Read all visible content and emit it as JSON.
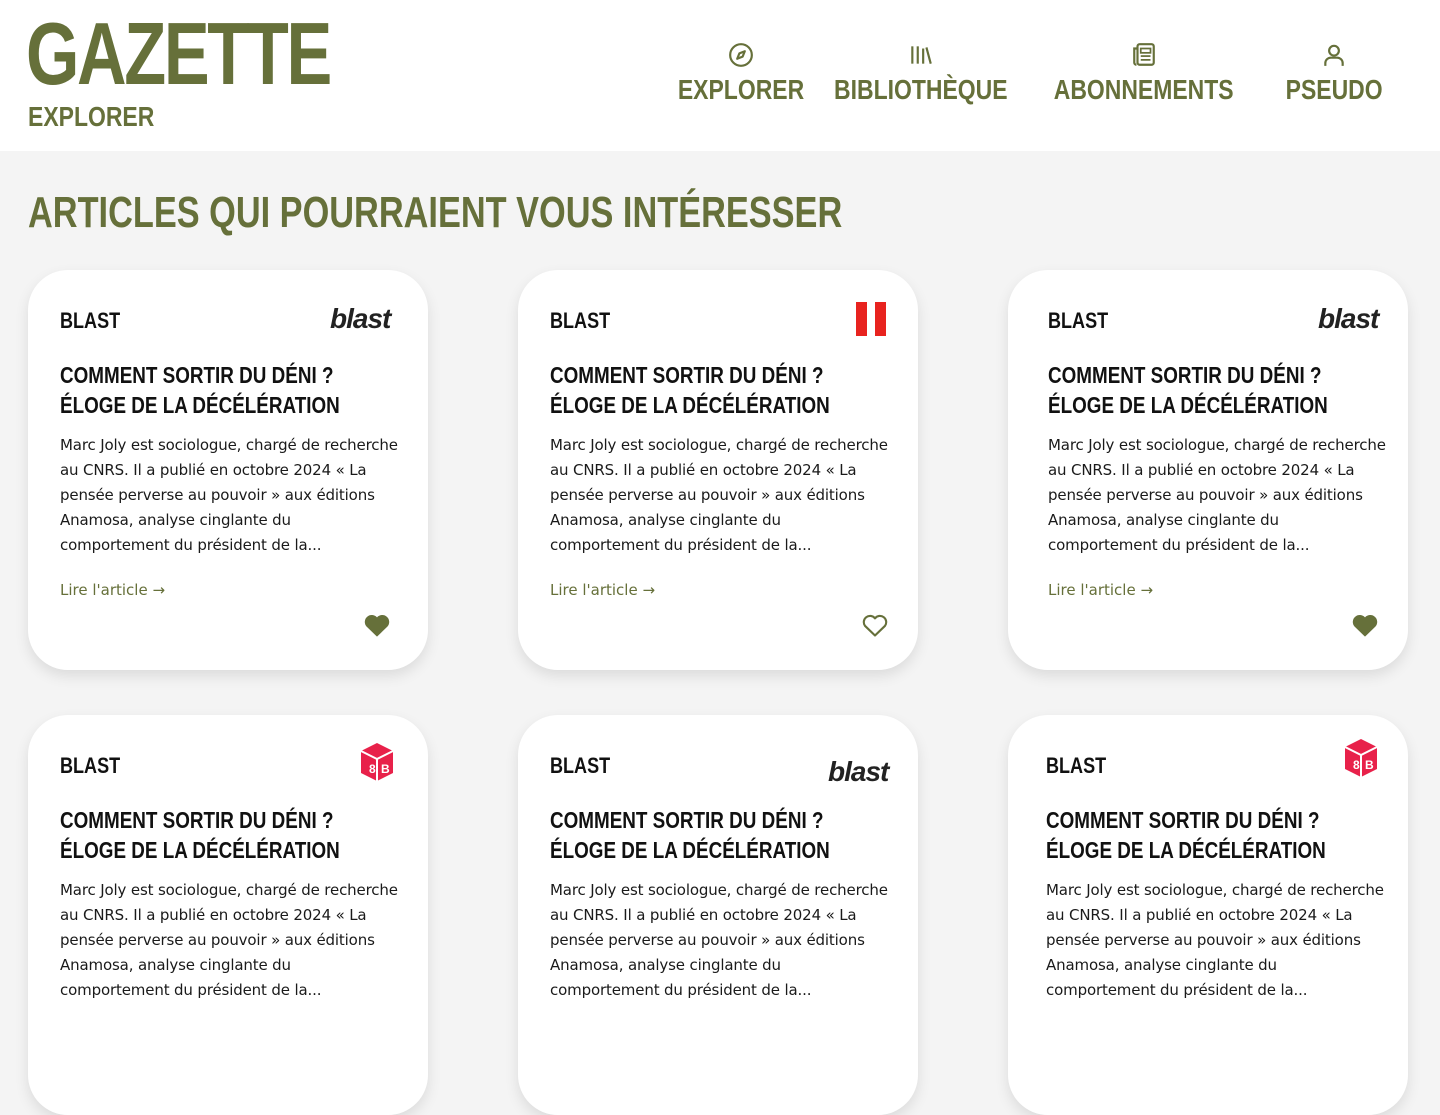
{
  "header": {
    "logo": "GAZETTE",
    "subtitle": "EXPLORER",
    "nav": [
      {
        "label": "EXPLORER",
        "icon": "compass-icon"
      },
      {
        "label": "BIBLIOTHÈQUE",
        "icon": "library-icon"
      },
      {
        "label": "ABONNEMENTS",
        "icon": "newspaper-icon"
      },
      {
        "label": "PSEUDO",
        "icon": "user-icon"
      }
    ]
  },
  "main": {
    "section_title": "ARTICLES QUI POURRAIENT VOUS INTÉRESSER",
    "cards": [
      {
        "source": "BLAST",
        "logo_text": "blast",
        "logo_icon": "blast-logo-icon",
        "title": "COMMENT SORTIR DU DÉNI ? ÉLOGE DE LA DÉCÉLÉRATION",
        "excerpt": "Marc Joly est sociologue, chargé de recherche au CNRS. Il a publié en octobre 2024 « La pensée perverse au pouvoir » aux éditions Anamosa, analyse cinglante du comportement du président de la...",
        "link": "Lire l'article →",
        "liked": true
      },
      {
        "source": "BLAST",
        "logo_text": "",
        "logo_icon": "red-bars-logo-icon",
        "title": "COMMENT SORTIR DU DÉNI ? ÉLOGE DE LA DÉCÉLÉRATION",
        "excerpt": "Marc Joly est sociologue, chargé de recherche au CNRS. Il a publié en octobre 2024 « La pensée perverse au pouvoir » aux éditions Anamosa, analyse cinglante du comportement du président de la...",
        "link": "Lire l'article →",
        "liked": false
      },
      {
        "source": "BLAST",
        "logo_text": "blast",
        "logo_icon": "blast-logo-icon",
        "title": "COMMENT SORTIR DU DÉNI ? ÉLOGE DE LA DÉCÉLÉRATION",
        "excerpt": "Marc Joly est sociologue, chargé de recherche au CNRS. Il a publié en octobre 2024 « La pensée perverse au pouvoir » aux éditions Anamosa, analyse cinglante du comportement du président de la...",
        "link": "Lire l'article →",
        "liked": true
      },
      {
        "source": "BLAST",
        "logo_text": "",
        "logo_icon": "pink-cube-logo-icon",
        "title": "COMMENT SORTIR DU DÉNI ? ÉLOGE DE LA DÉCÉLÉRATION",
        "excerpt": "Marc Joly est sociologue, chargé de recherche au CNRS. Il a publié en octobre 2024 « La pensée perverse au pouvoir » aux éditions Anamosa, analyse cinglante du comportement du président de la...",
        "link": "",
        "liked": false
      },
      {
        "source": "BLAST",
        "logo_text": "blast",
        "logo_icon": "blast-logo-icon",
        "title": "COMMENT SORTIR DU DÉNI ? ÉLOGE DE LA DÉCÉLÉRATION",
        "excerpt": "Marc Joly est sociologue, chargé de recherche au CNRS. Il a publié en octobre 2024 « La pensée perverse au pouvoir » aux éditions Anamosa, analyse cinglante du comportement du président de la...",
        "link": "",
        "liked": false
      },
      {
        "source": "BLAST",
        "logo_text": "",
        "logo_icon": "pink-cube-logo-icon",
        "title": "COMMENT SORTIR DU DÉNI ? ÉLOGE DE LA DÉCÉLÉRATION",
        "excerpt": "Marc Joly est sociologue, chargé de recherche au CNRS. Il a publié en octobre 2024 « La pensée perverse au pouvoir » aux éditions Anamosa, analyse cinglante du comportement du président de la...",
        "link": "",
        "liked": false
      }
    ]
  },
  "colors": {
    "brand_olive": "#66703a",
    "background": "#f4f4f4",
    "card": "#ffffff",
    "logo_red": "#e8231f",
    "logo_pink": "#e8214a"
  }
}
